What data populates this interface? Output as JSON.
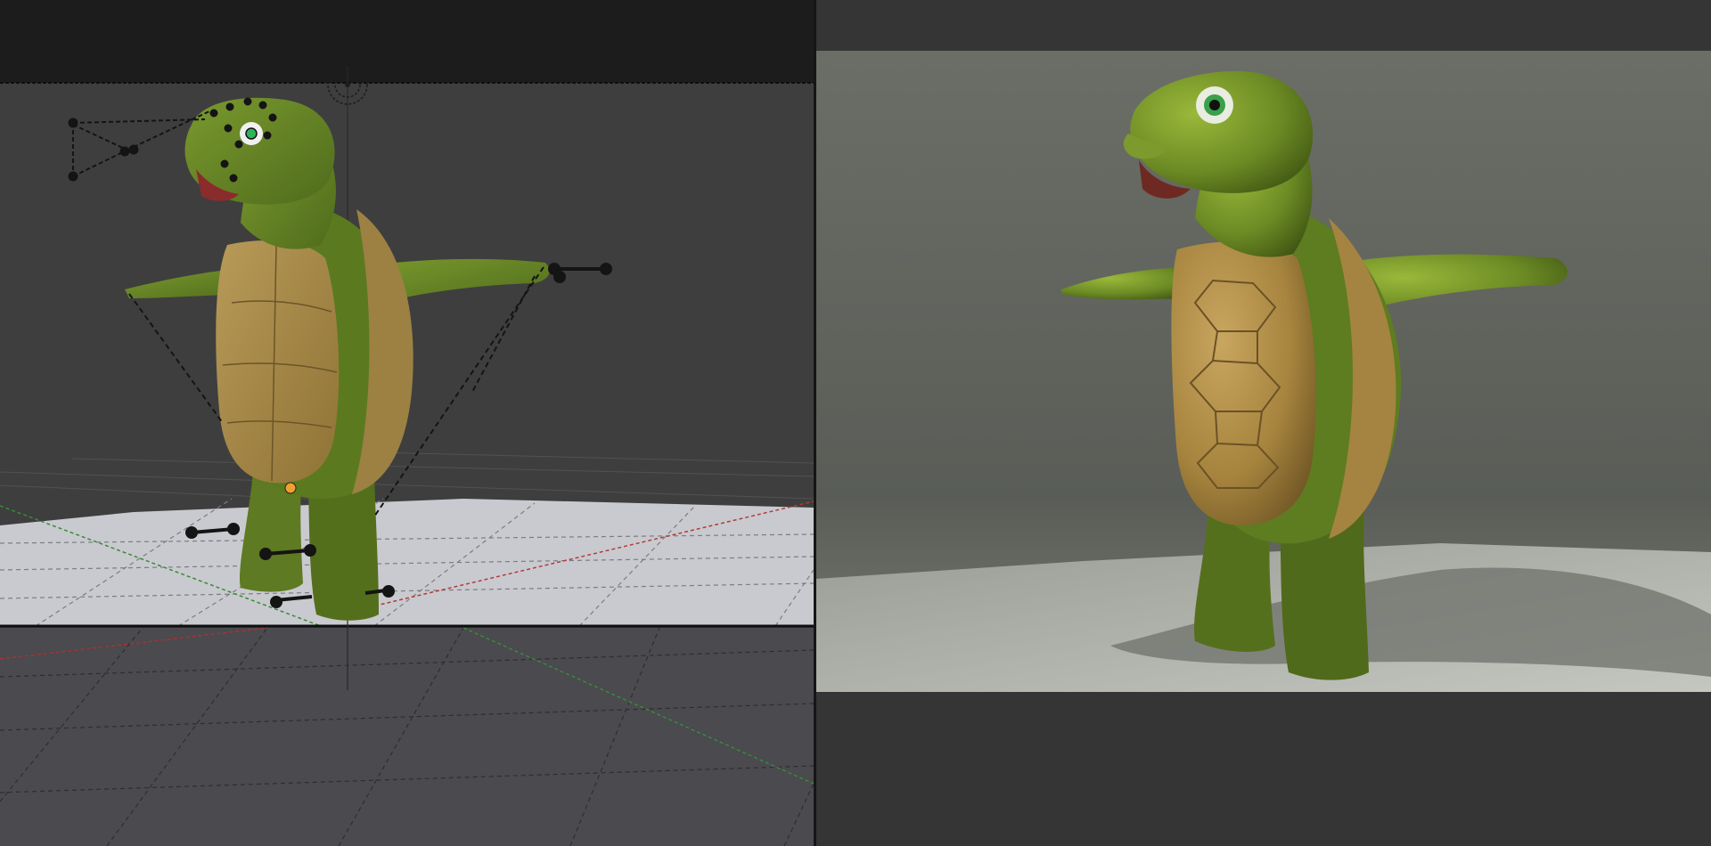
{
  "app": {
    "title": ""
  },
  "viewports": {
    "left": {
      "mode": "solid-viewport"
    },
    "right": {
      "mode": "rendered-viewport"
    }
  },
  "colors": {
    "background": "#2b2b2b",
    "viewport_left": "#3d3d3d",
    "viewport_right": "#353535",
    "camera_frame_dark": "#1a1a1a",
    "grid_line": "#8a8a8a",
    "axis_x": "#a83232",
    "axis_y": "#3d8a3d",
    "turtle_skin": "#6f8f2a",
    "turtle_shell": "#a58a4a",
    "render_backdrop": "#5e625c",
    "render_floor": "#a8aba5"
  },
  "icons": {
    "camera": "camera-icon",
    "light": "light-icon",
    "rig_bone": "bone-icon",
    "origin": "origin-icon"
  }
}
